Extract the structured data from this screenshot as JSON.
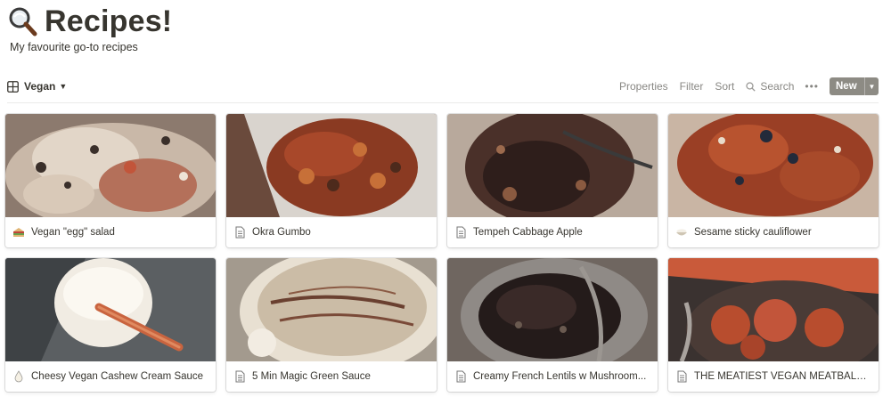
{
  "page": {
    "title": "Recipes!",
    "subtitle": "My favourite go-to recipes",
    "icon": "magnifying-glass-icon"
  },
  "toolbar": {
    "view_label": "Vegan",
    "view_icon": "gallery-view-icon",
    "properties": "Properties",
    "filter": "Filter",
    "sort": "Sort",
    "search": "Search",
    "more": "•••",
    "new": "New"
  },
  "cards": [
    {
      "title": "Vegan \"egg\" salad",
      "icon": "sandwich-icon"
    },
    {
      "title": "Okra Gumbo",
      "icon": "page-icon"
    },
    {
      "title": "Tempeh Cabbage Apple",
      "icon": "page-icon"
    },
    {
      "title": "Sesame sticky cauliflower",
      "icon": "rice-bowl-icon"
    },
    {
      "title": "Cheesy Vegan Cashew Cream Sauce",
      "icon": "droplet-icon"
    },
    {
      "title": "5 Min Magic Green Sauce",
      "icon": "page-icon"
    },
    {
      "title": "Creamy French Lentils w Mushroom...",
      "icon": "page-icon"
    },
    {
      "title": "THE MEATIEST VEGAN MEATBALLS ...",
      "icon": "page-icon"
    }
  ],
  "colors": {
    "text": "#37352f",
    "muted": "#9b9a97",
    "new_button": "#8d8b84"
  }
}
